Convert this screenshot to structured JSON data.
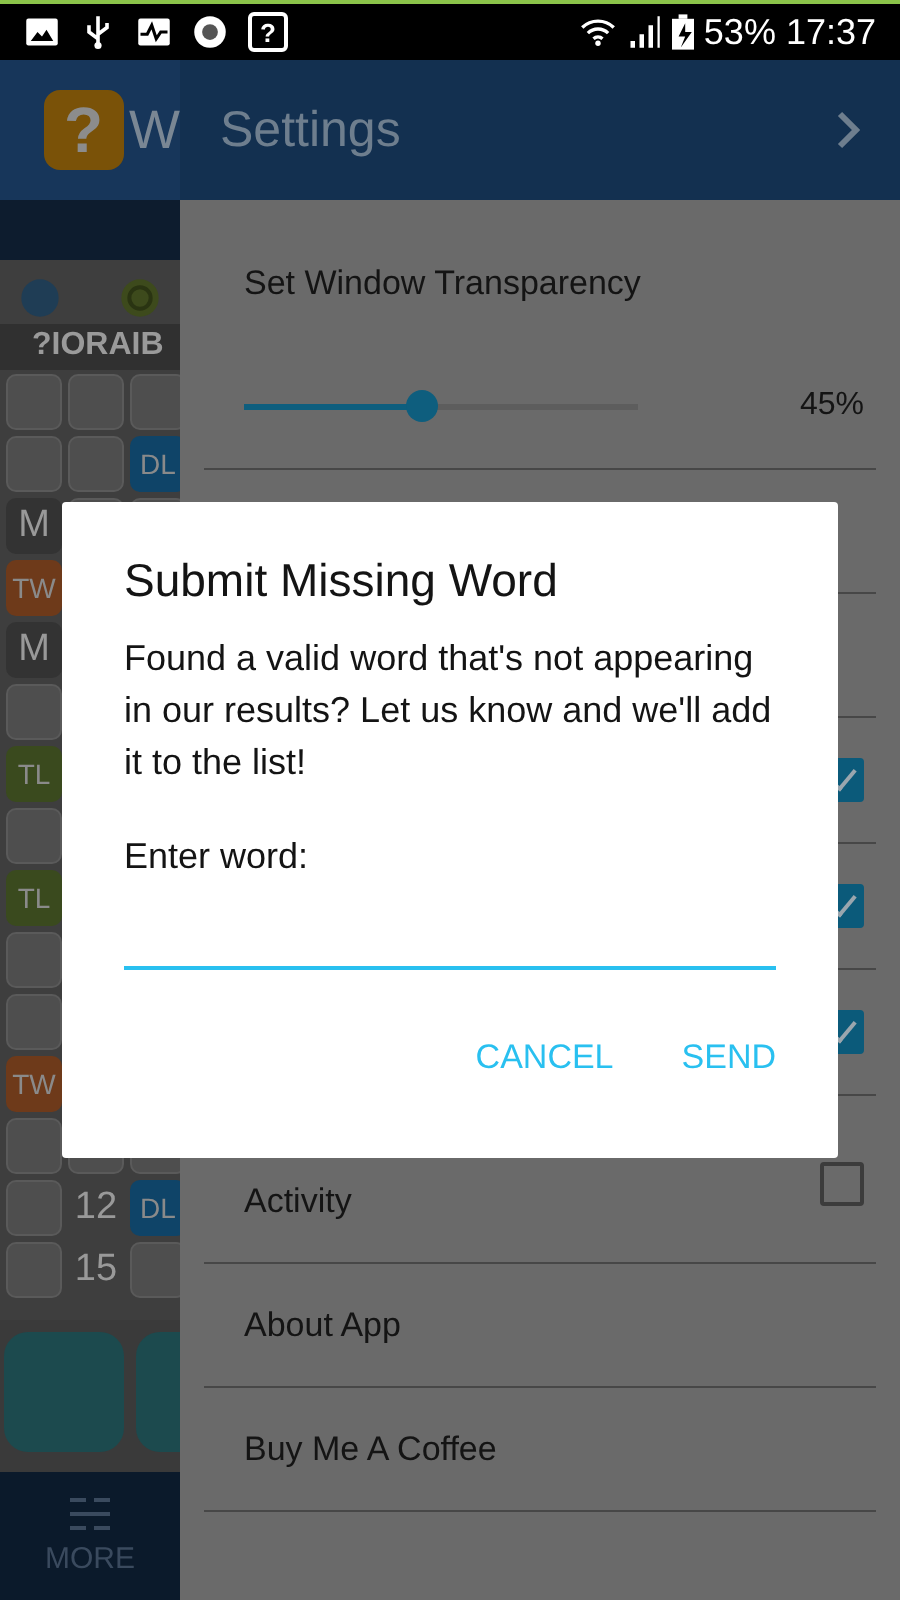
{
  "status_bar": {
    "notification_glyph": "?",
    "battery": "53%",
    "time": "17:37"
  },
  "background_app": {
    "logo_glyph": "?",
    "title": "W",
    "word_label": "?IORAIB",
    "more_label": "MORE",
    "rows": [
      [
        {
          "kind": "tile"
        },
        {
          "kind": "tile"
        },
        {
          "kind": "tile"
        }
      ],
      [
        {
          "kind": "tile"
        },
        {
          "kind": "tile"
        },
        {
          "kind": "badge",
          "text": "DL",
          "color": "#0f4468"
        }
      ],
      [
        {
          "kind": "letter",
          "text": "M"
        },
        {
          "kind": "tile"
        },
        {
          "kind": "tile"
        }
      ],
      [
        {
          "kind": "badge",
          "text": "TW",
          "color": "#6e3a1a"
        }
      ],
      [
        {
          "kind": "letter",
          "text": "M"
        }
      ],
      [
        {
          "kind": "tile"
        }
      ],
      [
        {
          "kind": "badge",
          "text": "TL",
          "color": "#3a4a1e"
        }
      ],
      [
        {
          "kind": "tile"
        }
      ],
      [
        {
          "kind": "badge",
          "text": "TL",
          "color": "#3a4a1e"
        }
      ],
      [
        {
          "kind": "tile"
        }
      ],
      [
        {
          "kind": "tile"
        }
      ],
      [
        {
          "kind": "badge",
          "text": "TW",
          "color": "#6e3a1a"
        }
      ],
      [
        {
          "kind": "tile"
        },
        {
          "kind": "tile"
        },
        {
          "kind": "tile"
        }
      ],
      [
        {
          "kind": "tile"
        },
        {
          "kind": "number",
          "text": "12"
        },
        {
          "kind": "badge",
          "text": "DL",
          "color": "#0f4468"
        }
      ],
      [
        {
          "kind": "tile"
        },
        {
          "kind": "number",
          "text": "15"
        },
        {
          "kind": "tile"
        }
      ]
    ]
  },
  "drawer": {
    "title": "Settings",
    "transparency": {
      "label": "Set Window Transparency",
      "level": 0.45,
      "reading": "45%"
    },
    "items": [
      {
        "kind": "blank"
      },
      {
        "kind": "blank"
      },
      {
        "kind": "checkbox",
        "checked": true
      },
      {
        "kind": "checkbox",
        "checked": true
      },
      {
        "kind": "checkbox",
        "checked": true
      },
      {
        "kind": "checkbox",
        "label": "Activity",
        "checked": false
      },
      {
        "kind": "link",
        "label": "About App"
      },
      {
        "kind": "link",
        "label": "Buy Me A Coffee"
      }
    ]
  },
  "dialog": {
    "title": "Submit Missing Word",
    "message": "Found a valid word that's not appearing in our results? Let us know and we'll add it to the list!",
    "field_label": "Enter word:",
    "buttons": [
      "CANCEL",
      "SEND"
    ]
  }
}
